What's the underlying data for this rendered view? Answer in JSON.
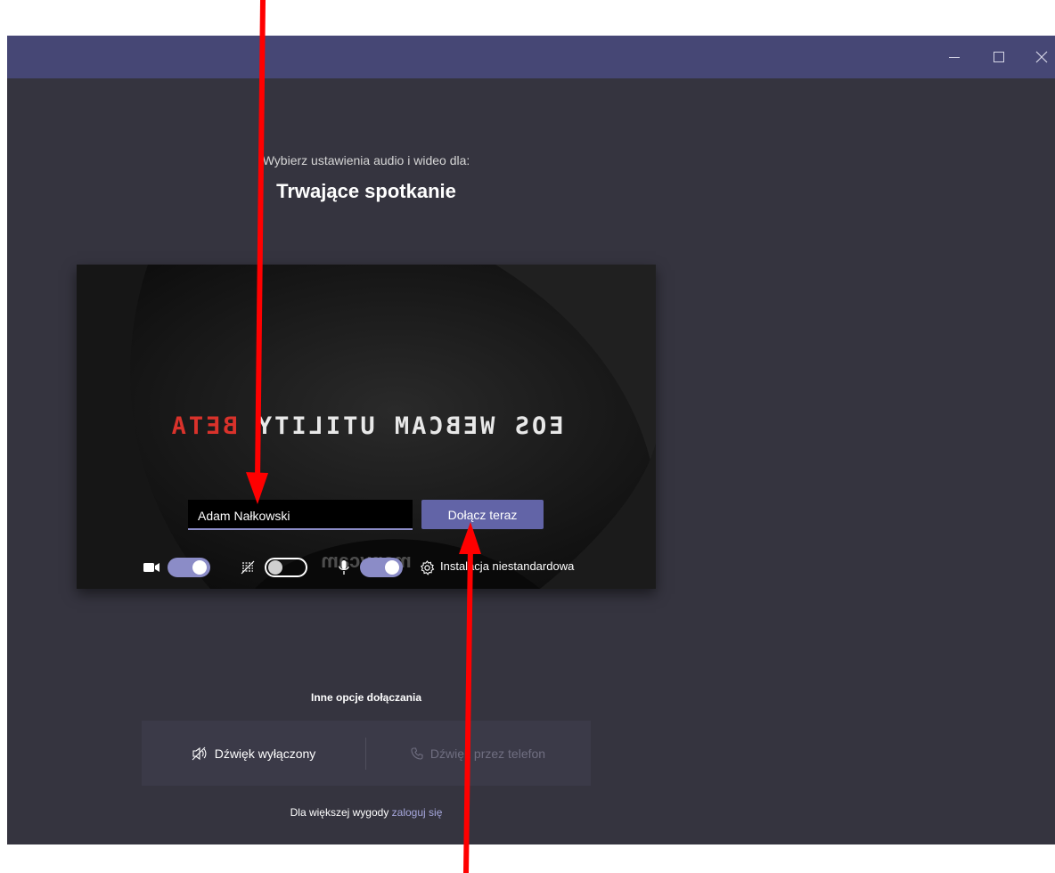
{
  "window": {
    "minimize_label": "—",
    "maximize_label": "☐",
    "close_label": "✕"
  },
  "prejoin": {
    "subtitle": "Wybierz ustawienia audio i wideo dla:",
    "meeting_title": "Trwające spotkanie"
  },
  "video_preview": {
    "overlay_text_main": "EOS WEBCAM UTILITY ",
    "overlay_text_beta": "BETA",
    "watermark": "manycam"
  },
  "join_form": {
    "name_value": "Adam Nałkowski",
    "join_button_label": "Dołącz teraz"
  },
  "controls": {
    "camera": {
      "icon": "camera-icon",
      "state": "on"
    },
    "blur": {
      "icon": "background-blur-icon",
      "state": "off"
    },
    "microphone": {
      "icon": "microphone-icon",
      "state": "on"
    },
    "settings_icon": "gear-icon",
    "settings_label": "Instalacja niestandardowa"
  },
  "other_options": {
    "heading": "Inne opcje dołączania",
    "audio_off_label": "Dźwięk wyłączony",
    "phone_audio_label": "Dźwięk przez telefon"
  },
  "footer": {
    "prefix": "Dla większej wygody ",
    "link_label": "zaloguj się"
  },
  "colors": {
    "titlebar": "#464775",
    "background": "#35343f",
    "accent": "#6264a7",
    "toggle_on": "#8b8cc7",
    "annotation_arrow": "#ff0000"
  }
}
